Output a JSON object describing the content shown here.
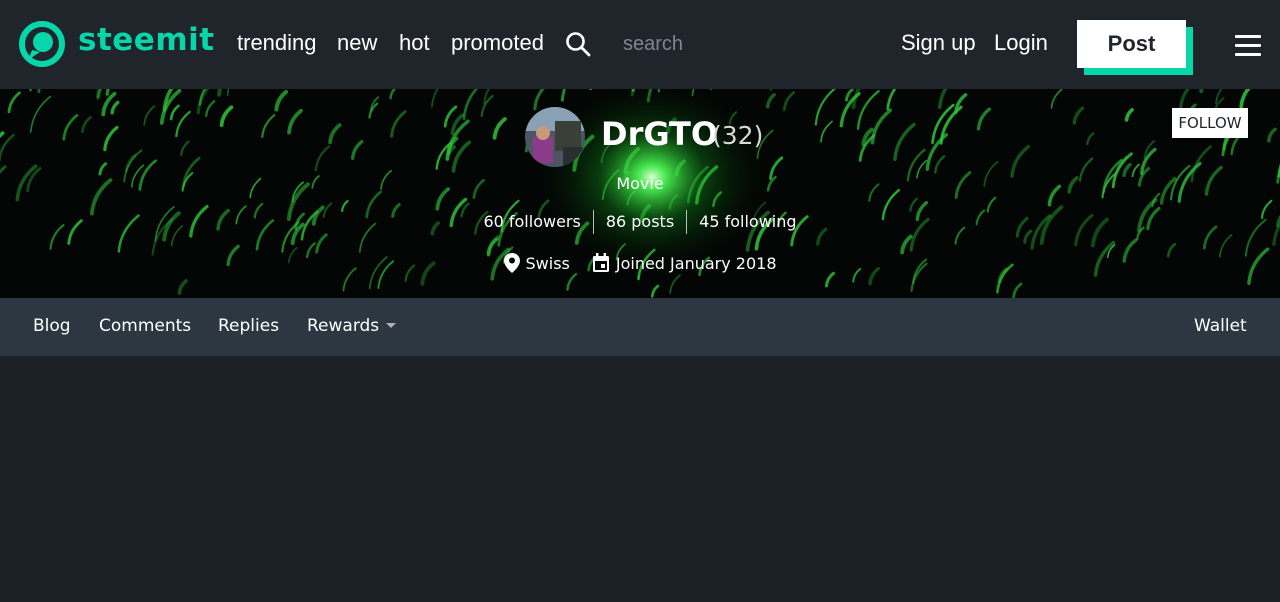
{
  "header": {
    "brand": "steemit",
    "nav": [
      "trending",
      "new",
      "hot",
      "promoted"
    ],
    "search_placeholder": "search",
    "signup_label": "Sign up",
    "login_label": "Login",
    "post_label": "Post",
    "accent_color": "#06d6a9"
  },
  "profile": {
    "username": "DrGTO",
    "reputation": "(32)",
    "about": "Movie",
    "followers": "60 followers",
    "posts": "86 posts",
    "following": "45 following",
    "location": "Swiss",
    "joined": "Joined January 2018",
    "follow_label": "FOLLOW",
    "location_icon": "location-pin-icon",
    "calendar_icon": "calendar-icon"
  },
  "tabs": {
    "blog": "Blog",
    "comments": "Comments",
    "replies": "Replies",
    "rewards": "Rewards",
    "wallet": "Wallet"
  }
}
